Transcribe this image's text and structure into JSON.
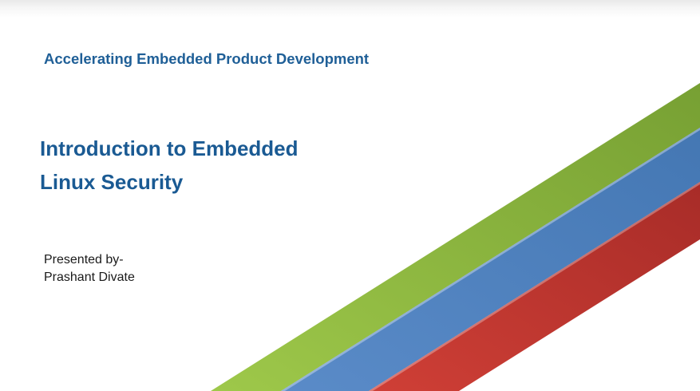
{
  "slide": {
    "tagline": "Accelerating Embedded Product Development",
    "title_line_1": "Introduction to Embedded",
    "title_line_2": "Linux Security",
    "presented_by_label": "Presented by-",
    "presenter_name": "Prashant Divate"
  },
  "decoration": {
    "stripe_colors": {
      "green": "#8cb840",
      "blue": "#4f81bd",
      "red": "#c0392f"
    }
  }
}
